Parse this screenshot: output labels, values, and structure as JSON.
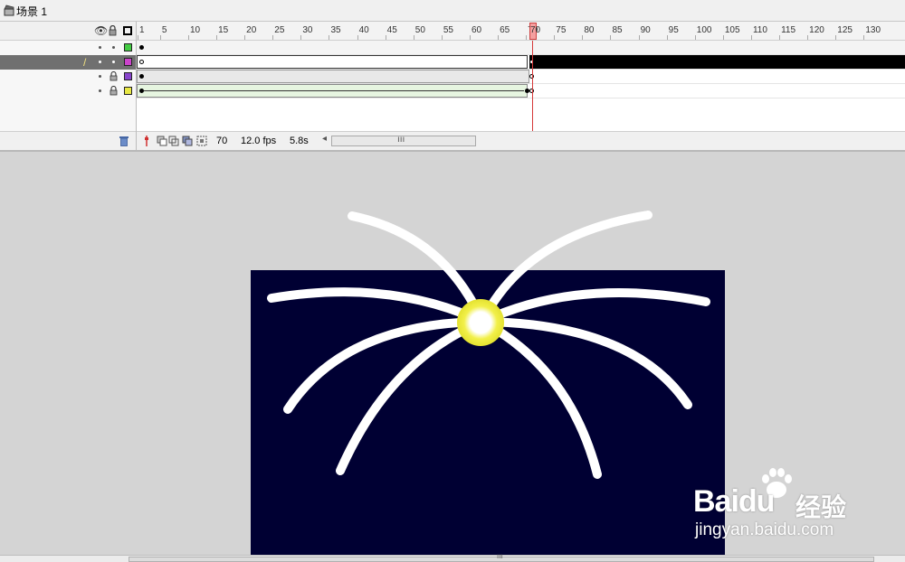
{
  "scene": {
    "label": "场景 1",
    "icon": "clapperboard-icon"
  },
  "timeline": {
    "header_icons": [
      "eye-icon",
      "lock-icon",
      "outline-icon"
    ],
    "ruler_numbers": [
      "1",
      "5",
      "10",
      "15",
      "20",
      "25",
      "30",
      "35",
      "40",
      "45",
      "50",
      "55",
      "60",
      "65",
      "70",
      "75",
      "80",
      "85",
      "90",
      "95",
      "100",
      "105",
      "110",
      "115",
      "120",
      "125",
      "130"
    ],
    "current_frame_marker": "70",
    "layers": [
      {
        "color": "#44cc44",
        "selected": false,
        "locked": false
      },
      {
        "color": "#cc44cc",
        "selected": true,
        "locked": false
      },
      {
        "color": "#8844cc",
        "selected": false,
        "locked": true
      },
      {
        "color": "#e8e844",
        "selected": false,
        "locked": true
      }
    ],
    "status": {
      "current_frame": "70",
      "frame_rate": "12.0 fps",
      "elapsed_time": "5.8s"
    }
  },
  "stage": {
    "background_color": "#000033",
    "stroke_color": "#ffffff",
    "center_color": "#f2f04a"
  },
  "watermark": {
    "logo_text": "Baidu",
    "cn_text": "经验",
    "url_text": "jingyan.baidu.com"
  }
}
